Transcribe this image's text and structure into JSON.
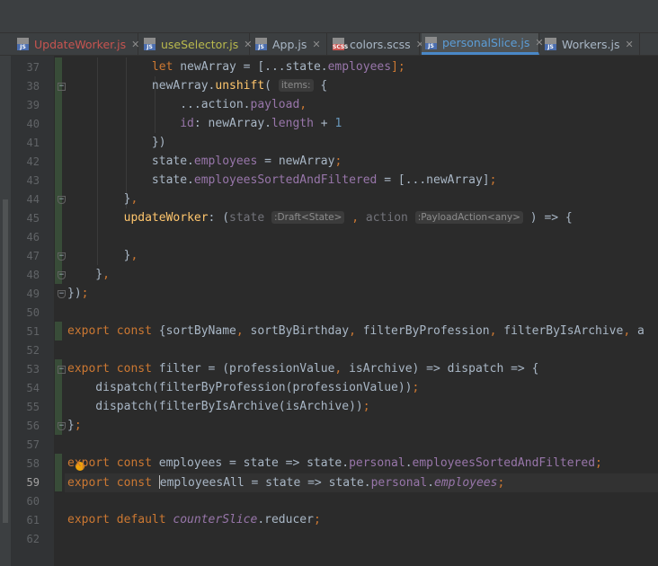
{
  "tabs": [
    {
      "label": "UpdateWorker.js",
      "type": "js",
      "color": "#c75450",
      "active": false
    },
    {
      "label": "useSelector.js",
      "type": "js",
      "color": "#b9b94d",
      "active": false
    },
    {
      "label": "App.js",
      "type": "js",
      "color": "#a9b7c6",
      "active": false
    },
    {
      "label": "colors.scss",
      "type": "scss",
      "color": "#a9b7c6",
      "active": false
    },
    {
      "label": "personalSlice.js",
      "type": "js",
      "color": "#5c9dd6",
      "active": true
    },
    {
      "label": "Workers.js",
      "type": "js",
      "color": "#a9b7c6",
      "active": false
    }
  ],
  "editor": {
    "current_line": 59,
    "lines": [
      {
        "n": "37",
        "tokens": [
          [
            "            "
          ],
          [
            "let ",
            "kw"
          ],
          [
            "newArray = [...state."
          ],
          [
            "employees",
            "prop"
          ],
          [
            "];",
            "kw"
          ]
        ]
      },
      {
        "n": "38",
        "tokens": [
          [
            "            newArray."
          ],
          [
            "unshift",
            "fn"
          ],
          [
            "( "
          ],
          [
            "items:",
            "hint"
          ],
          [
            " {"
          ]
        ]
      },
      {
        "n": "39",
        "tokens": [
          [
            "                ...action."
          ],
          [
            "payload",
            "prop"
          ],
          [
            ",",
            "kw"
          ]
        ]
      },
      {
        "n": "40",
        "tokens": [
          [
            "                "
          ],
          [
            "id",
            "prop"
          ],
          [
            ": newArray."
          ],
          [
            "length",
            "prop"
          ],
          [
            " + "
          ],
          [
            "1",
            "num"
          ]
        ]
      },
      {
        "n": "41",
        "tokens": [
          [
            "            })"
          ]
        ]
      },
      {
        "n": "42",
        "tokens": [
          [
            "            state."
          ],
          [
            "employees",
            "prop"
          ],
          [
            " = newArray"
          ],
          [
            ";",
            "kw"
          ]
        ]
      },
      {
        "n": "43",
        "tokens": [
          [
            "            state."
          ],
          [
            "employeesSortedAndFiltered",
            "prop"
          ],
          [
            " = [...newArray]"
          ],
          [
            ";",
            "kw"
          ]
        ]
      },
      {
        "n": "44",
        "tokens": [
          [
            "        }"
          ],
          [
            ",",
            "kw"
          ]
        ]
      },
      {
        "n": "45",
        "tokens": [
          [
            "        "
          ],
          [
            "updateWorker",
            "fn"
          ],
          [
            ": ("
          ],
          [
            "state",
            "param"
          ],
          [
            " "
          ],
          [
            ":Draft<State>",
            "hint"
          ],
          [
            " "
          ],
          [
            ", ",
            "kw"
          ],
          [
            "action",
            "param"
          ],
          [
            " "
          ],
          [
            ":PayloadAction<any>",
            "hint"
          ],
          [
            " ) => {"
          ]
        ]
      },
      {
        "n": "46",
        "tokens": [
          [
            ""
          ]
        ]
      },
      {
        "n": "47",
        "tokens": [
          [
            "        }"
          ],
          [
            ",",
            "kw"
          ]
        ]
      },
      {
        "n": "48",
        "tokens": [
          [
            "    }"
          ],
          [
            ",",
            "kw"
          ]
        ]
      },
      {
        "n": "49",
        "tokens": [
          [
            "})"
          ],
          [
            ";",
            "kw"
          ]
        ]
      },
      {
        "n": "50",
        "tokens": [
          [
            ""
          ]
        ]
      },
      {
        "n": "51",
        "tokens": [
          [
            "export const ",
            "kw"
          ],
          [
            "{sortByName"
          ],
          [
            ", ",
            "kw"
          ],
          [
            "sortByBirthday"
          ],
          [
            ", ",
            "kw"
          ],
          [
            "filterByProfession"
          ],
          [
            ", ",
            "kw"
          ],
          [
            "filterByIsArchive"
          ],
          [
            ", ",
            "kw"
          ],
          [
            "a"
          ]
        ]
      },
      {
        "n": "52",
        "tokens": [
          [
            ""
          ]
        ]
      },
      {
        "n": "53",
        "tokens": [
          [
            "export const ",
            "kw"
          ],
          [
            "filter = (professionValue"
          ],
          [
            ", ",
            "kw"
          ],
          [
            "isArchive) => dispatch => {"
          ]
        ]
      },
      {
        "n": "54",
        "tokens": [
          [
            "    dispatch(filterByProfession(professionValue))"
          ],
          [
            ";",
            "kw"
          ]
        ]
      },
      {
        "n": "55",
        "tokens": [
          [
            "    dispatch(filterByIsArchive(isArchive))"
          ],
          [
            ";",
            "kw"
          ]
        ]
      },
      {
        "n": "56",
        "tokens": [
          [
            "}"
          ],
          [
            ";",
            "kw"
          ]
        ]
      },
      {
        "n": "57",
        "tokens": [
          [
            ""
          ]
        ]
      },
      {
        "n": "58",
        "tokens": [
          [
            "export const ",
            "kw"
          ],
          [
            "employees = state => state."
          ],
          [
            "personal",
            "prop"
          ],
          [
            "."
          ],
          [
            "employeesSortedAndFiltered",
            "prop"
          ],
          [
            ";",
            "kw"
          ]
        ]
      },
      {
        "n": "59",
        "tokens": [
          [
            "export const ",
            "kw"
          ],
          [
            "",
            "cursor"
          ],
          [
            "employeesAll = state => state."
          ],
          [
            "personal",
            "prop"
          ],
          [
            "."
          ],
          [
            "employees",
            "prop it"
          ],
          [
            ";",
            "kw"
          ]
        ]
      },
      {
        "n": "60",
        "tokens": [
          [
            ""
          ]
        ]
      },
      {
        "n": "61",
        "tokens": [
          [
            "export default ",
            "kw"
          ],
          [
            "counterSlice",
            "prop it"
          ],
          [
            "."
          ],
          [
            "reducer"
          ],
          [
            ";",
            "kw"
          ]
        ]
      },
      {
        "n": "62",
        "tokens": [
          [
            ""
          ]
        ]
      }
    ]
  }
}
